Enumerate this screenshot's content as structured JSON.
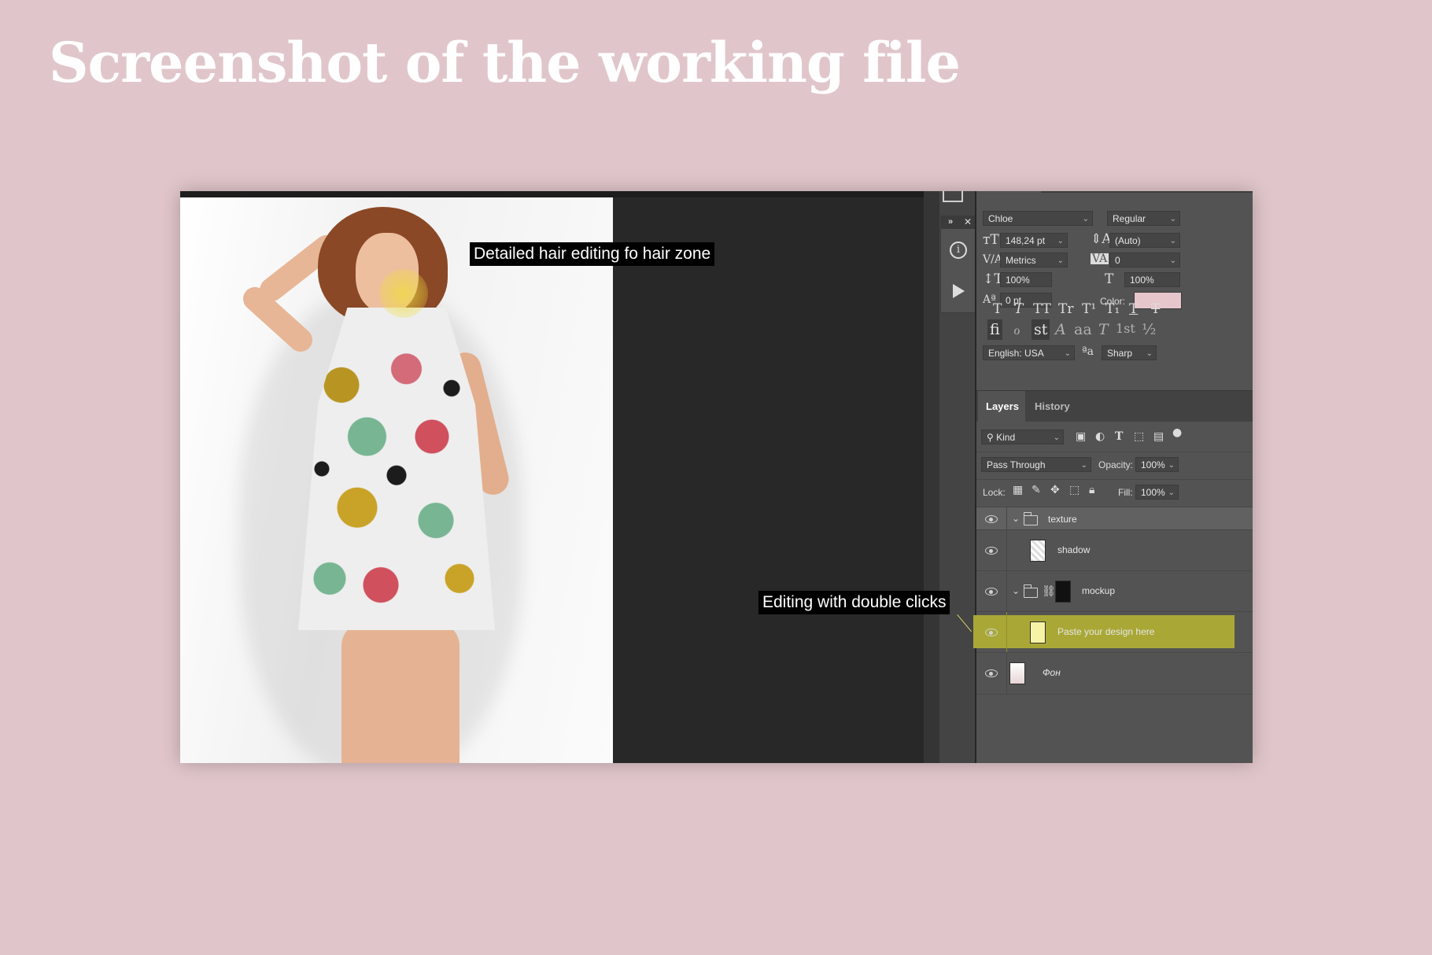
{
  "page_title": "Screenshot of the working file",
  "annotations": {
    "hair": "Detailed hair editing fo hair zone",
    "double_click": "Editing with double clicks"
  },
  "character_panel": {
    "font_family": "Chloe",
    "font_style": "Regular",
    "font_size": "148,24 pt",
    "leading": "(Auto)",
    "kerning": "Metrics",
    "tracking": "0",
    "vertical_scale": "100%",
    "horizontal_scale": "100%",
    "baseline_shift": "0 pt",
    "color_label": "Color:",
    "color_value": "#e6c6cb",
    "style_buttons": [
      "T",
      "T",
      "TT",
      "Tr",
      "T¹",
      "T₁",
      "T",
      "T"
    ],
    "opentype_buttons": [
      "ﬁ",
      "ℴ",
      "st",
      "A",
      "aa",
      "T",
      "1st",
      "½"
    ],
    "language": "English: USA",
    "aa_icon": "ªa",
    "antialias": "Sharp"
  },
  "layers_panel": {
    "tabs": [
      "Layers",
      "History"
    ],
    "filter_kind": "Kind",
    "blend_mode": "Pass Through",
    "opacity_label": "Opacity:",
    "opacity": "100%",
    "lock_label": "Lock:",
    "fill_label": "Fill:",
    "fill": "100%",
    "layers": [
      {
        "name": "texture",
        "type": "group"
      },
      {
        "name": "shadow",
        "type": "layer"
      },
      {
        "name": "mockup",
        "type": "group"
      },
      {
        "name": "Paste your design here",
        "type": "smart-object",
        "selected": true
      },
      {
        "name": "Фон",
        "type": "background"
      }
    ]
  },
  "colors": {
    "background": "#e0c6ca",
    "selected_layer": "#a9a836",
    "panel": "#535353"
  }
}
